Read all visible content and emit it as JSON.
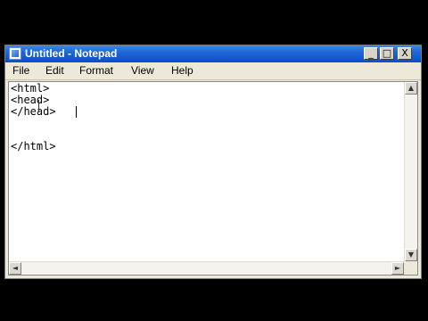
{
  "window": {
    "title": "Untitled - Notepad",
    "icon": "notepad-icon",
    "title_bar_color": "#1e66d6",
    "buttons": {
      "minimize": "_",
      "maximize": "□",
      "close": "X"
    }
  },
  "menu": {
    "items": [
      {
        "label": "File"
      },
      {
        "label": "Edit"
      },
      {
        "label": "Format"
      },
      {
        "label": "View"
      },
      {
        "label": "Help"
      }
    ]
  },
  "editor": {
    "content": "<html>\n<head>\n</head>\n\n\n</html>"
  },
  "scrollbars": {
    "up": "▲",
    "down": "▼",
    "left": "◄",
    "right": "►"
  }
}
